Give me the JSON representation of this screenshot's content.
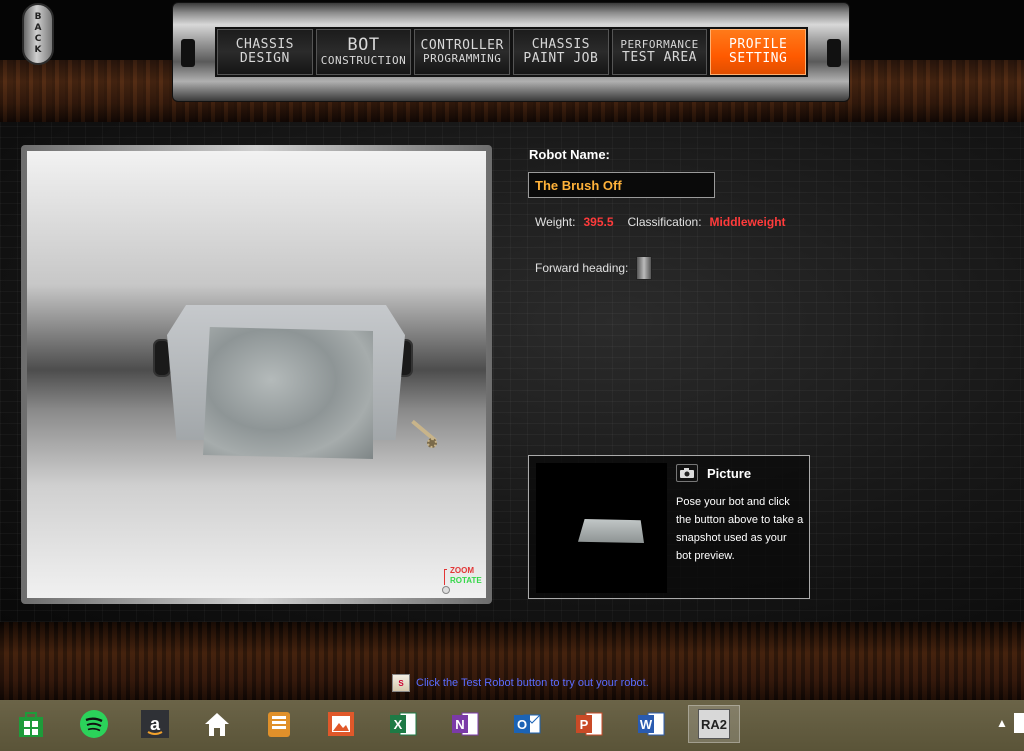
{
  "back_button": {
    "label": "BACK"
  },
  "nav": {
    "tabs": [
      {
        "line1": "CHASSIS",
        "line2": "DESIGN",
        "active": false
      },
      {
        "line1": "BOT",
        "line2": "CONSTRUCTION",
        "active": false
      },
      {
        "line1": "CONTROLLER",
        "line2": "PROGRAMMING",
        "active": false
      },
      {
        "line1": "CHASSIS",
        "line2": "PAINT JOB",
        "active": false
      },
      {
        "line1": "PERFORMANCE",
        "line2": "TEST AREA",
        "active": false
      },
      {
        "line1": "PROFILE",
        "line2": "SETTING",
        "active": true
      }
    ]
  },
  "viewport": {
    "zoom_label": "ZOOM",
    "rotate_label": "ROTATE"
  },
  "profile": {
    "robot_name_label": "Robot Name:",
    "robot_name_value": "The Brush Off",
    "weight_label": "Weight:",
    "weight_value": "395.5",
    "classification_label": "Classification:",
    "classification_value": "Middleweight",
    "forward_heading_label": "Forward heading:"
  },
  "picture": {
    "label": "Picture",
    "description": "Pose your bot and click the button above to take a snapshot used as your bot preview."
  },
  "hint": {
    "icon_text": "S",
    "text": "Click the Test Robot button to try out your robot."
  },
  "taskbar": {
    "items": [
      "store-icon",
      "spotify-icon",
      "amazon-icon",
      "home-icon",
      "files-icon",
      "photos-icon",
      "excel-icon",
      "onenote-icon",
      "outlook-icon",
      "powerpoint-icon",
      "word-icon",
      "ra2-icon"
    ],
    "ra2_label": "RA2",
    "tray_caret": "▲"
  },
  "colors": {
    "accent_orange": "#ff5a00",
    "name_text": "#ffb23a",
    "stat_red": "#ff3b3b",
    "hint_blue": "#5a6cff"
  }
}
